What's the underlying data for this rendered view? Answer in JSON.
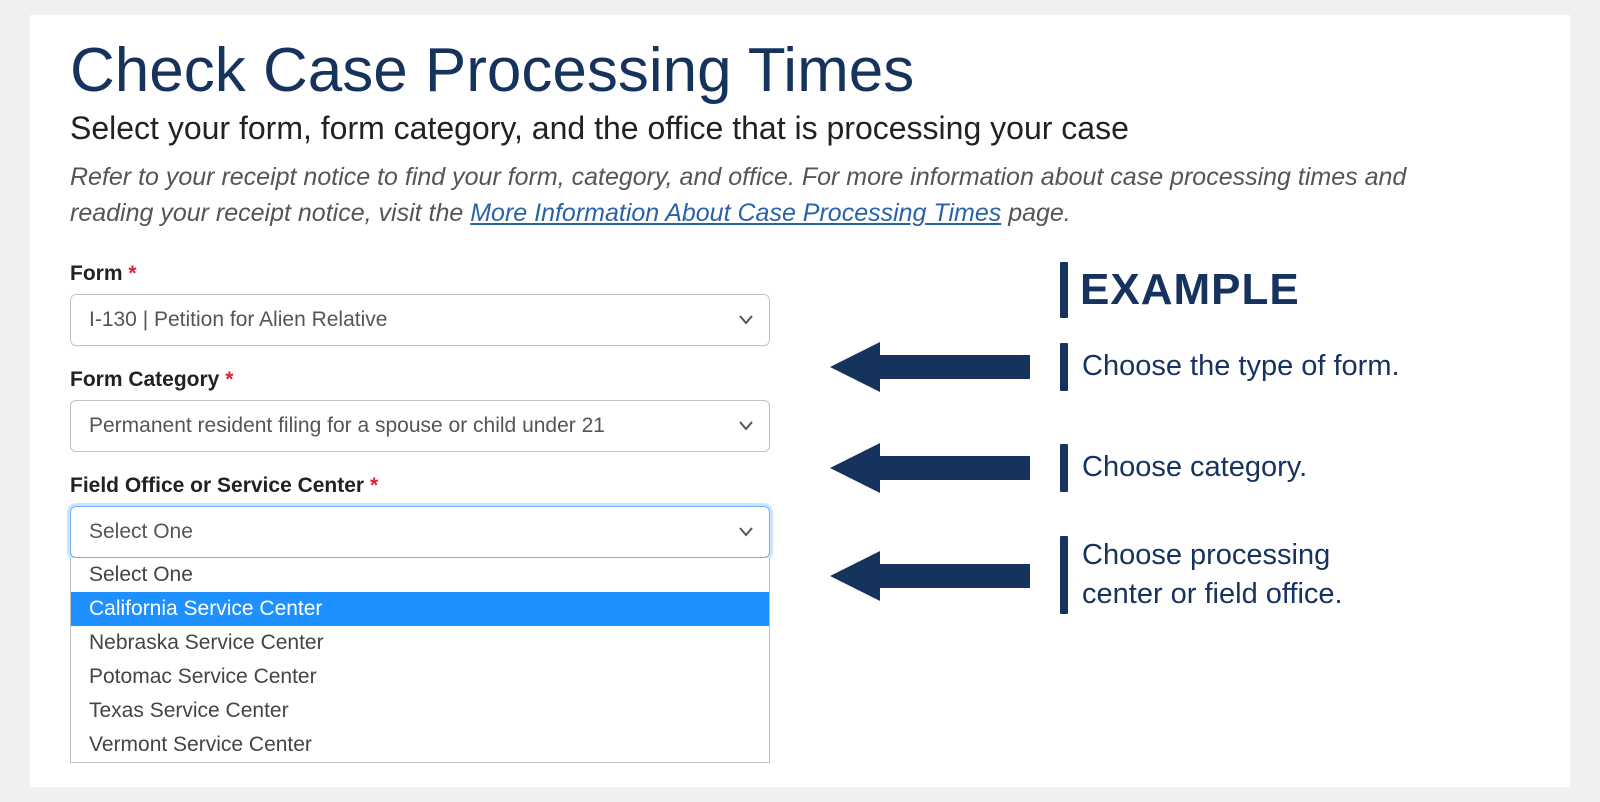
{
  "page_title": "Check Case Processing Times",
  "page_subtitle": "Select your form, form category, and the office that is processing your case",
  "page_description_pre": "Refer to your receipt notice to find your form, category, and office. For more information about case processing times and reading your receipt notice, visit the ",
  "page_description_link": "More Information About Case Processing Times",
  "page_description_post": " page.",
  "form": {
    "form_label": "Form",
    "form_value": "I-130 | Petition for Alien Relative",
    "category_label": "Form Category",
    "category_value": "Permanent resident filing for a spouse or child under 21",
    "office_label": "Field Office or Service Center",
    "office_value": "Select One",
    "office_options": [
      {
        "label": "Select One"
      },
      {
        "label": "California Service Center"
      },
      {
        "label": "Nebraska Service Center"
      },
      {
        "label": "Potomac Service Center"
      },
      {
        "label": "Texas Service Center"
      },
      {
        "label": "Vermont Service Center"
      }
    ],
    "office_highlighted_index": 1
  },
  "annotations": {
    "header": "EXAMPLE",
    "row0": "Choose the type of form.",
    "row1": "Choose category.",
    "row2": "Choose processing center or field office."
  },
  "colors": {
    "navy": "#16335d",
    "highlight": "#1e90ff"
  }
}
